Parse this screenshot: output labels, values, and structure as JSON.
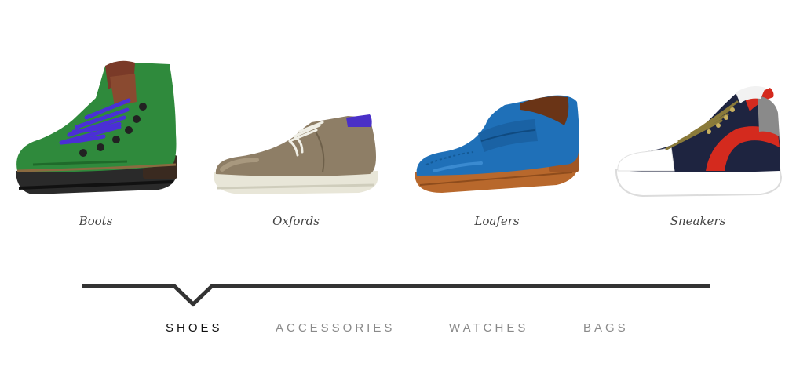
{
  "products": [
    {
      "label": "Boots",
      "icon": "boot-icon"
    },
    {
      "label": "Oxfords",
      "icon": "oxford-shoe-icon"
    },
    {
      "label": "Loafers",
      "icon": "loafer-icon"
    },
    {
      "label": "Sneakers",
      "icon": "sneaker-icon"
    }
  ],
  "tabs": [
    {
      "label": "SHOES",
      "active": true
    },
    {
      "label": "ACCESSORIES",
      "active": false
    },
    {
      "label": "WATCHES",
      "active": false
    },
    {
      "label": "BAGS",
      "active": false
    }
  ],
  "colors": {
    "active_tab": "#111111",
    "inactive_tab": "#8a8a8a",
    "nav_line": "#333333",
    "caption": "#444444"
  }
}
